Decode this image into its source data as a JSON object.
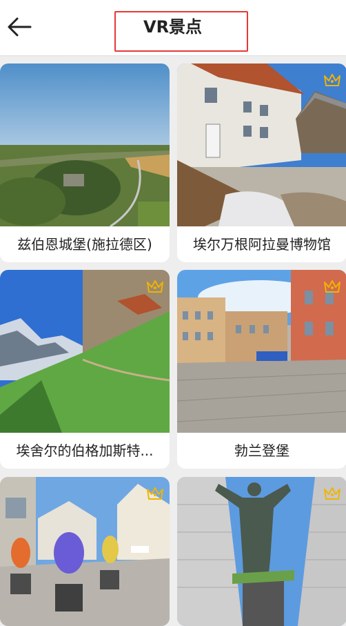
{
  "header": {
    "title": "VR景点",
    "back_icon": "arrow-left-icon"
  },
  "accent_color": "#e53935",
  "premium_color": "#f0b400",
  "attractions": [
    {
      "name": "兹伯恩城堡(施拉德区)",
      "premium": false
    },
    {
      "name": "埃尔万根阿拉曼博物馆",
      "premium": true
    },
    {
      "name": "埃舍尔的伯格加斯特...",
      "premium": true
    },
    {
      "name": "勃兰登堡",
      "premium": true
    },
    {
      "name": "",
      "premium": true
    },
    {
      "name": "",
      "premium": true
    }
  ]
}
